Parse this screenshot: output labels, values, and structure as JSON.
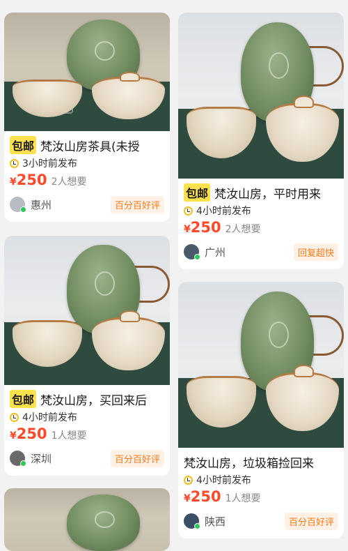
{
  "listings": [
    {
      "free_shipping": "包邮",
      "title": "梵汝山房茶具(未授",
      "time": "3小时前发布",
      "currency": "¥",
      "price": "250",
      "wants": "2人想要",
      "location": "惠州",
      "tag": "百分百好评",
      "avatar_color": "#b8bcc4"
    },
    {
      "free_shipping": "包邮",
      "title": "梵汝山房，平时用来",
      "time": "4小时前发布",
      "currency": "¥",
      "price": "250",
      "wants": "2人想要",
      "location": "广州",
      "tag": "回复超快",
      "avatar_color": "#4a5a6a"
    },
    {
      "free_shipping": "包邮",
      "title": "梵汝山房，买回来后",
      "time": "4小时前发布",
      "currency": "¥",
      "price": "250",
      "wants": "1人想要",
      "location": "深圳",
      "tag": "百分百好评",
      "avatar_color": "#6a6a6a"
    },
    {
      "title": "梵汝山房，垃圾箱捡回来",
      "time": "4小时前发布",
      "currency": "¥",
      "price": "250",
      "wants": "1人想要",
      "location": "陕西",
      "tag": "百分百好评",
      "avatar_color": "#3b4e66"
    }
  ],
  "colors": {
    "price": "#ff4a2a",
    "free_shipping_bg": "#ffe14d",
    "tag_text": "#ff7a1a",
    "tag_bg": "#fff1e6",
    "online": "#2ec95a"
  }
}
